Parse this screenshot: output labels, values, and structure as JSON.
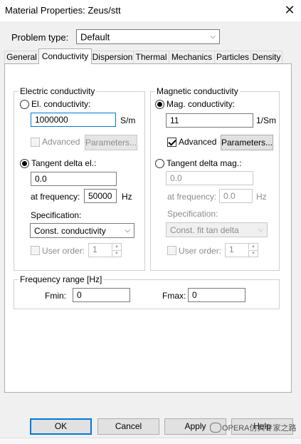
{
  "window": {
    "title": "Material Properties: Zeus/stt",
    "close_glyph": "✕"
  },
  "problem_type": {
    "label": "Problem type:",
    "value": "Default"
  },
  "tabs": [
    {
      "label": "General"
    },
    {
      "label": "Conductivity"
    },
    {
      "label": "Dispersion"
    },
    {
      "label": "Thermal"
    },
    {
      "label": "Mechanics"
    },
    {
      "label": "Particles"
    },
    {
      "label": "Density"
    }
  ],
  "active_tab": "Conductivity",
  "electric": {
    "group_title": "Electric conductivity",
    "el_conductivity_label": "El. conductivity:",
    "el_conductivity_value": "1000000",
    "el_unit": "S/m",
    "advanced_label": "Advanced",
    "parameters_label": "Parameters...",
    "tangent_label": "Tangent delta el.:",
    "tangent_value": "0.0",
    "freq_label": "at frequency:",
    "freq_value": "50000",
    "freq_unit": "Hz",
    "spec_label": "Specification:",
    "spec_value": "Const. conductivity",
    "user_order_label": "User order:",
    "user_order_value": "1"
  },
  "magnetic": {
    "group_title": "Magnetic conductivity",
    "mag_conductivity_label": "Mag. conductivity:",
    "mag_conductivity_value": "11",
    "mag_unit": "1/Sm",
    "advanced_label": "Advanced",
    "parameters_label": "Parameters...",
    "tangent_label": "Tangent delta mag.:",
    "tangent_value": "0.0",
    "freq_label": "at frequency:",
    "freq_value": "0.0",
    "freq_unit": "Hz",
    "spec_label": "Specification:",
    "spec_value": "Const. fit tan delta",
    "user_order_label": "User order:",
    "user_order_value": "1"
  },
  "frequency_range": {
    "group_title": "Frequency range [Hz]",
    "fmin_label": "Fmin:",
    "fmin_value": "0",
    "fmax_label": "Fmax:",
    "fmax_value": "0"
  },
  "buttons": {
    "ok": "OK",
    "cancel": "Cancel",
    "apply": "Apply",
    "help": "Help"
  },
  "watermark": "OPERA仿真专家之路"
}
